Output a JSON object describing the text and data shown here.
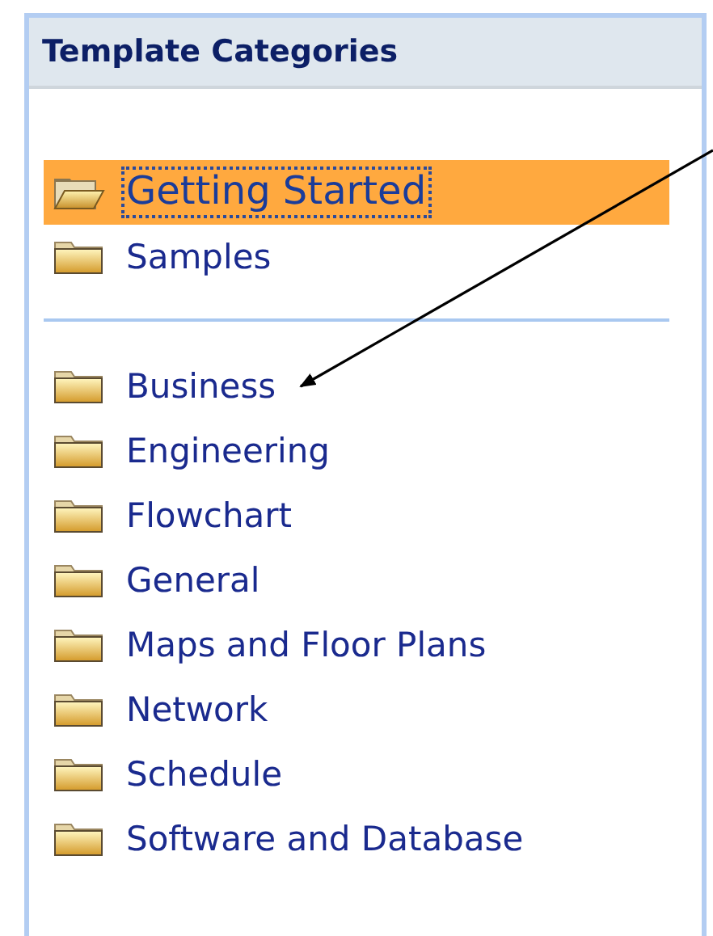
{
  "panel": {
    "title": "Template Categories"
  },
  "groups": [
    {
      "items": [
        {
          "label": "Getting Started",
          "selected": true
        },
        {
          "label": "Samples",
          "selected": false
        }
      ]
    },
    {
      "items": [
        {
          "label": "Business",
          "selected": false
        },
        {
          "label": "Engineering",
          "selected": false
        },
        {
          "label": "Flowchart",
          "selected": false
        },
        {
          "label": "General",
          "selected": false
        },
        {
          "label": "Maps and Floor Plans",
          "selected": false
        },
        {
          "label": "Network",
          "selected": false
        },
        {
          "label": "Schedule",
          "selected": false
        },
        {
          "label": "Software and Database",
          "selected": false
        }
      ]
    }
  ]
}
